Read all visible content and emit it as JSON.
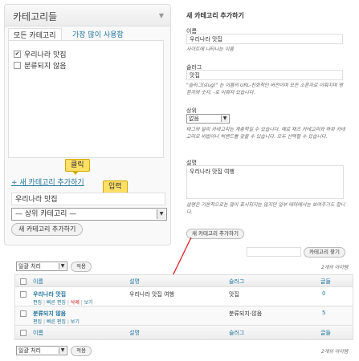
{
  "category_box": {
    "title": "카테고리들",
    "collapse_arrow": "▼",
    "tab_all": "모든 카테고리",
    "tab_popular": "가장 많이 사용함",
    "items": [
      {
        "label": "우리나라 맛집",
        "checked": true
      },
      {
        "label": "분류되지 않음",
        "checked": false
      }
    ],
    "add_new_link": "+ 새 카테고리 추가하기",
    "new_category_value": "우리나라 맛집",
    "parent_select": "— 상위 카테고리 —",
    "add_button": "새 카테고리 추가하기"
  },
  "callouts": {
    "click": "클릭",
    "input": "입력"
  },
  "add_form": {
    "title": "새 카테고리 추가하기",
    "name_label": "이름",
    "name_value": "우리나라 맛집",
    "name_hint": "사이트에 나타나는 이름",
    "slug_label": "슬러그",
    "slug_value": "맛집",
    "slug_hint": "\"슬러그(slug)\" 는 이름의 URL-친화적인 버전이며 모든 소문자로 이뤄지며 영문자와 숫자, -로 이뤄져 있습니다.",
    "parent_label": "상위",
    "parent_value": "없음",
    "parent_hint": "태그와 달리 카테고리는 계층적일 수 있습니다. 예로 재즈 카테고리와 하위 카테고리로 비밥이나 빅밴드를 갖을 수 있습니다. 모두 선택할 수 있습니다.",
    "desc_label": "설명",
    "desc_value": "우리나라 맛집 여행",
    "desc_hint": "설명은 기본적으로는 많이 표시되지는 않지만 일부 테마에서는 보여주기도 합니다.",
    "submit": "새 카테고리 추가하기"
  },
  "search": {
    "value": "",
    "button": "카테고리 찾기"
  },
  "bulk_top": {
    "select": "일괄 처리",
    "apply": "적용",
    "count": "2개의 아이템"
  },
  "bulk_bottom": {
    "select": "일괄 처리",
    "apply": "적용",
    "count": "2개의 아이템"
  },
  "table": {
    "headers": [
      "이름",
      "설명",
      "슬러그",
      "글들"
    ],
    "rows": [
      {
        "name": "우리나라 맛집",
        "description": "우리나라 맛집 여행",
        "slug": "맛집",
        "posts": "0",
        "actions": [
          "편집",
          "빠른 편집",
          "삭제",
          "보기"
        ]
      },
      {
        "name": "분류되지 않음",
        "description": "",
        "slug": "분류되지-않음",
        "posts": "5",
        "actions": [
          "편집",
          "빠른 편집",
          "보기"
        ]
      }
    ]
  },
  "colors": {
    "link": "#21759b",
    "delete": "#bc0b0b",
    "callout": "#ffe066",
    "arrow": "#e02020"
  }
}
